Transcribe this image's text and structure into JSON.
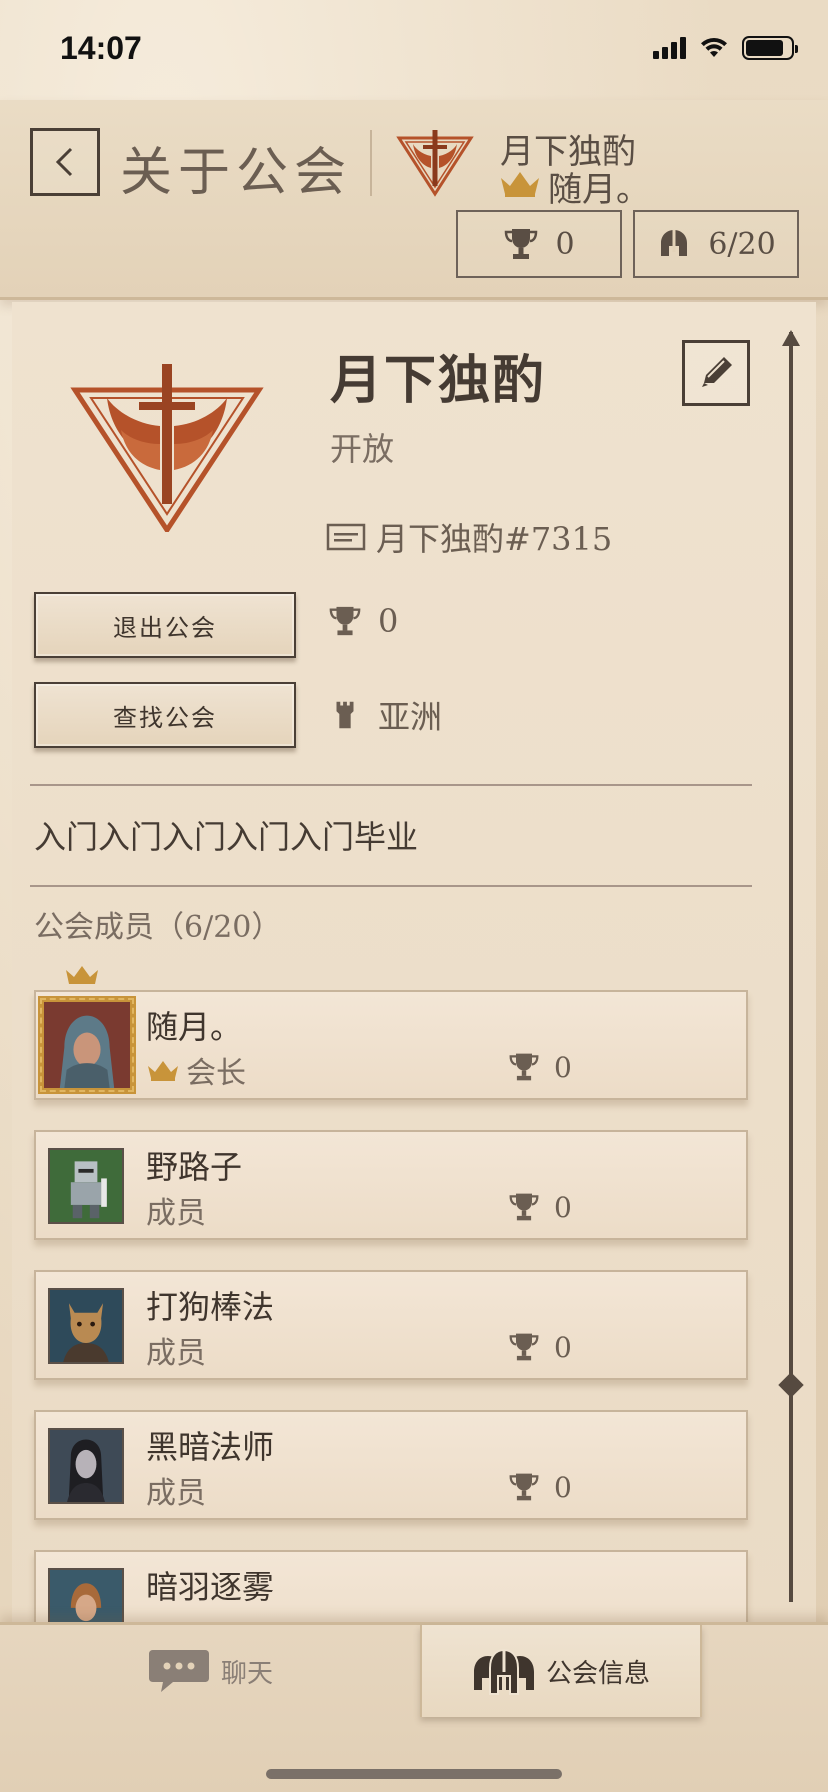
{
  "status_bar": {
    "time": "14:07",
    "battery_level": 0.85
  },
  "header": {
    "title": "关于公会",
    "guild_name": "月下独酌",
    "leader_name": "随月。",
    "trophies": "0",
    "members": "6/20",
    "icons": [
      "chevron-left-icon",
      "guild-emblem-icon",
      "crown-icon",
      "trophy-icon",
      "helmet-icon"
    ]
  },
  "guild": {
    "name": "月下独酌",
    "status": "开放",
    "tag": "月下独酌#7315",
    "trophies": "0",
    "region": "亚洲",
    "description": "入门入门入门入门入门毕业",
    "emblem_color": "#b5522a",
    "buttons": {
      "quit": "退出公会",
      "find": "查找公会"
    }
  },
  "members_section": {
    "label": "公会成员",
    "count": "（6/20）"
  },
  "members": [
    {
      "name": "随月。",
      "role": "会长",
      "trophies": "0",
      "is_leader": true
    },
    {
      "name": "野路子",
      "role": "成员",
      "trophies": "0",
      "is_leader": false
    },
    {
      "name": "打狗棒法",
      "role": "成员",
      "trophies": "0",
      "is_leader": false
    },
    {
      "name": "黑暗法师",
      "role": "成员",
      "trophies": "0",
      "is_leader": false
    },
    {
      "name": "暗羽逐雾",
      "role": "",
      "trophies": "",
      "is_leader": false
    }
  ],
  "tabs": {
    "chat": "聊天",
    "guild_info": "公会信息",
    "selected": "guild_info"
  },
  "colors": {
    "accent_gold": "#c8943a",
    "ink": "#4a3f36",
    "emblem": "#b5522a"
  }
}
